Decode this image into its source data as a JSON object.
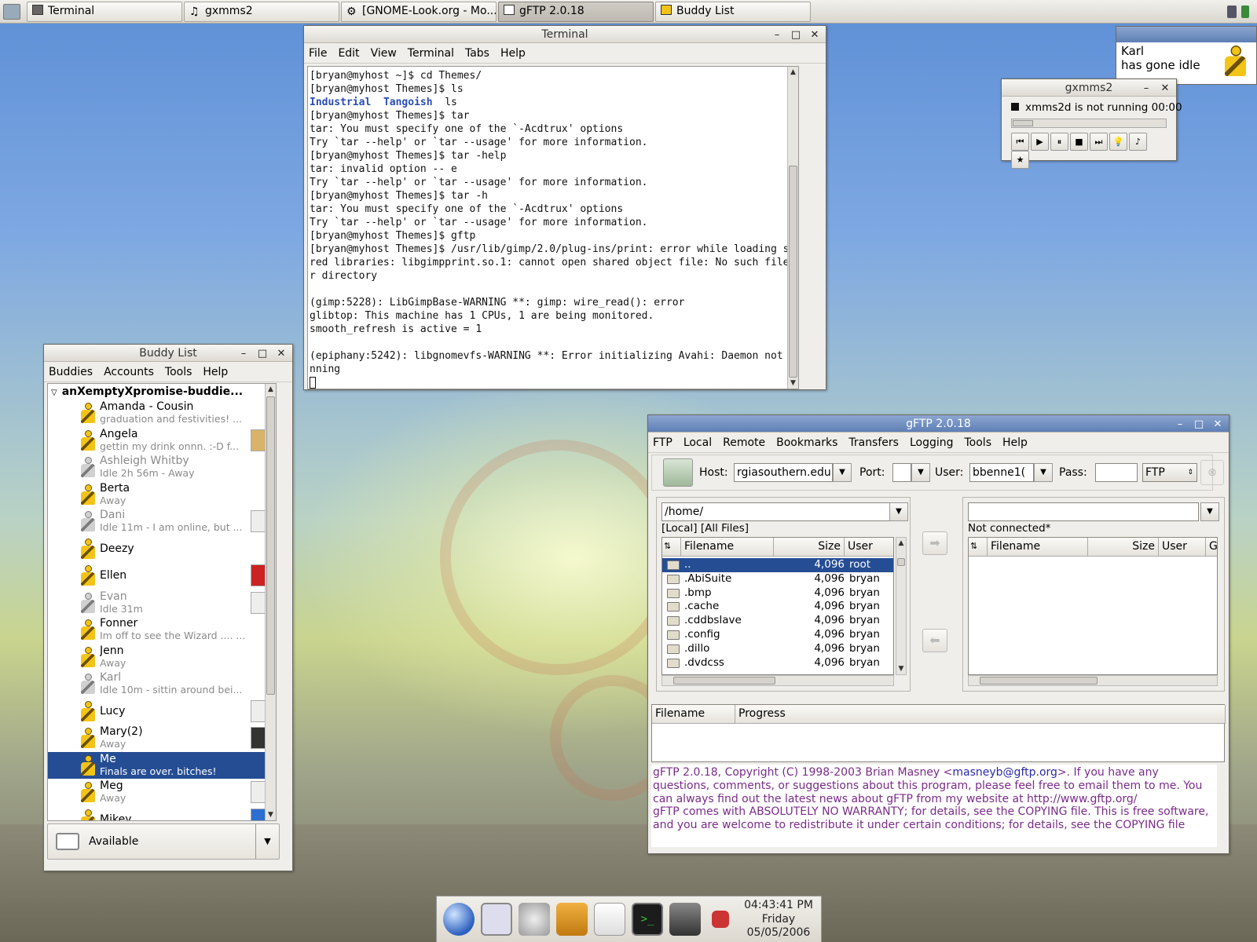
{
  "taskbar": {
    "buttons": [
      {
        "label": "Terminal"
      },
      {
        "label": "gxmms2"
      },
      {
        "label": "[GNOME-Look.org - Mo..."
      },
      {
        "label": "gFTP 2.0.18"
      },
      {
        "label": "Buddy List"
      }
    ]
  },
  "terminal": {
    "title": "Terminal",
    "menu": [
      "File",
      "Edit",
      "View",
      "Terminal",
      "Tabs",
      "Help"
    ],
    "lines": [
      "[bryan@myhost ~]$ cd Themes/",
      "[bryan@myhost Themes]$ ls",
      "",
      "[bryan@myhost Themes]$ tar",
      "tar: You must specify one of the `-Acdtrux' options",
      "Try `tar --help' or `tar --usage' for more information.",
      "[bryan@myhost Themes]$ tar -help",
      "tar: invalid option -- e",
      "Try `tar --help' or `tar --usage' for more information.",
      "[bryan@myhost Themes]$ tar -h",
      "tar: You must specify one of the `-Acdtrux' options",
      "Try `tar --help' or `tar --usage' for more information.",
      "[bryan@myhost Themes]$ gftp",
      "[bryan@myhost Themes]$ /usr/lib/gimp/2.0/plug-ins/print: error while loading sha",
      "red libraries: libgimpprint.so.1: cannot open shared object file: No such file o",
      "r directory",
      "",
      "(gimp:5228): LibGimpBase-WARNING **: gimp: wire_read(): error",
      "glibtop: This machine has 1 CPUs, 1 are being monitored.",
      "smooth_refresh is active = 1",
      "",
      "(epiphany:5242): libgnomevfs-WARNING **: Error initializing Avahi: Daemon not ru",
      "nning"
    ],
    "ls_dir1": "Industrial",
    "ls_dir2": "Tangoish",
    "ls_file": "ls"
  },
  "notification": {
    "name": "Karl",
    "message": "has gone idle"
  },
  "gxmms2": {
    "title": "gxmms2",
    "status": "xmms2d is not running 00:00"
  },
  "buddy_list": {
    "title": "Buddy List",
    "menu": [
      "Buddies",
      "Accounts",
      "Tools",
      "Help"
    ],
    "group": "anXemptyXpromise-buddie...",
    "buddies": [
      {
        "name": "Amanda - Cousin",
        "status": "graduation and festivities! ..."
      },
      {
        "name": "Angela",
        "status": "gettin my drink onnn. :-D  f..."
      },
      {
        "name": "Ashleigh Whitby",
        "status": "Idle 2h 56m - Away"
      },
      {
        "name": "Berta",
        "status": "Away"
      },
      {
        "name": "Dani",
        "status": "Idle 11m - I am online, but ..."
      },
      {
        "name": "Deezy",
        "status": ""
      },
      {
        "name": "Ellen",
        "status": ""
      },
      {
        "name": "Evan",
        "status": "Idle 31m"
      },
      {
        "name": "Fonner",
        "status": "Im off to see the Wizard .... ..."
      },
      {
        "name": "Jenn",
        "status": "Away"
      },
      {
        "name": "Karl",
        "status": "Idle 10m - sittin around bei..."
      },
      {
        "name": "Lucy",
        "status": ""
      },
      {
        "name": "Mary(2)",
        "status": "Away"
      },
      {
        "name": "Me",
        "status": "Finals are over. bitches!"
      },
      {
        "name": "Meg",
        "status": "Away"
      },
      {
        "name": "Mikey",
        "status": ""
      }
    ],
    "status_selector": "Available"
  },
  "gftp": {
    "title": "gFTP 2.0.18",
    "menu": [
      "FTP",
      "Local",
      "Remote",
      "Bookmarks",
      "Transfers",
      "Logging",
      "Tools",
      "Help"
    ],
    "host_label": "Host:",
    "host_value": "rgiasouthern.edu",
    "port_label": "Port:",
    "port_value": "",
    "user_label": "User:",
    "user_value": "bbenne1(",
    "pass_label": "Pass:",
    "protocol": "FTP",
    "local_path": "/home/",
    "local_label": "[Local] [All Files]",
    "remote_path": "",
    "remote_label": "Not connected*",
    "columns": {
      "filename": "Filename",
      "size": "Size",
      "user": "User",
      "extra": "G"
    },
    "files": [
      {
        "name": "..",
        "size": "4,096",
        "user": "root"
      },
      {
        "name": ".AbiSuite",
        "size": "4,096",
        "user": "bryan"
      },
      {
        "name": ".bmp",
        "size": "4,096",
        "user": "bryan"
      },
      {
        "name": ".cache",
        "size": "4,096",
        "user": "bryan"
      },
      {
        "name": ".cddbslave",
        "size": "4,096",
        "user": "bryan"
      },
      {
        "name": ".config",
        "size": "4,096",
        "user": "bryan"
      },
      {
        "name": ".dillo",
        "size": "4,096",
        "user": "bryan"
      },
      {
        "name": ".dvdcss",
        "size": "4,096",
        "user": "bryan"
      }
    ],
    "transfer_columns": {
      "filename": "Filename",
      "progress": "Progress"
    },
    "log_line1a": "gFTP 2.0.18, Copyright (C) 1998-2003 Brian Masney <",
    "log_email": "masneyb@gftp.org",
    "log_line1b": ">. If you have any questions, comments, or suggestions about this program, please feel free to email them to me. You can always find out the latest news about gFTP from my website at http://www.gftp.org/",
    "log_line2": "gFTP comes with ABSOLUTELY NO WARRANTY; for details, see the COPYING file. This is free software, and you are welcome to redistribute it under certain conditions; for details, see the COPYING file"
  },
  "clock": {
    "time": "04:43:41 PM",
    "day": "Friday",
    "date": "05/05/2006"
  },
  "colors": {
    "selection": "#254d94",
    "log_text": "#7a2c8a",
    "aim_yellow": "#f2c418"
  }
}
